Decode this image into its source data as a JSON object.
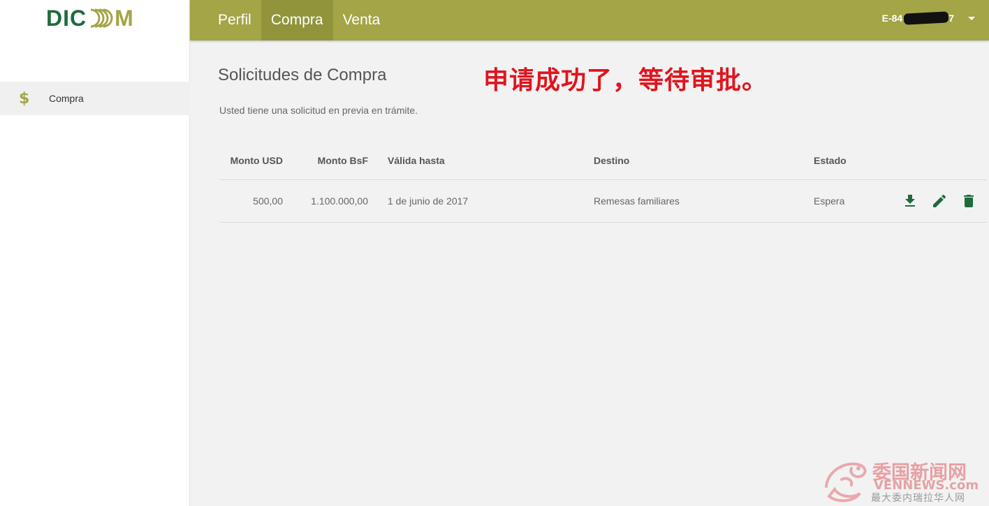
{
  "app": {
    "logo_text": "DIC",
    "logo_text_end": "M"
  },
  "sidebar": {
    "items": [
      {
        "icon": "dollar-icon",
        "icon_glyph": "$",
        "label": "Compra"
      }
    ]
  },
  "header": {
    "tabs": [
      {
        "label": "Perfil",
        "active": false
      },
      {
        "label": "Compra",
        "active": true
      },
      {
        "label": "Venta",
        "active": false
      }
    ],
    "user": {
      "id_prefix": "E-84",
      "id_suffix": "7",
      "menu_icon": "caret-down-icon"
    }
  },
  "main": {
    "title": "Solicitudes de Compra",
    "annotation": "申请成功了，等待审批。",
    "subtitle": "Usted tiene una solicitud en previa en trámite.",
    "table": {
      "headers": [
        "Monto USD",
        "Monto BsF",
        "Válida hasta",
        "Destino",
        "Estado"
      ],
      "rows": [
        {
          "monto_usd": "500,00",
          "monto_bsf": "1.100.000,00",
          "valida_hasta": "1 de junio de 2017",
          "destino": "Remesas familiares",
          "estado": "Espera",
          "actions": [
            "download-icon",
            "edit-icon",
            "delete-icon"
          ]
        }
      ]
    }
  },
  "watermark": {
    "cn": "委国新闻网",
    "en": "VENNEWS.com",
    "sub": "最大委内瑞拉华人网"
  },
  "colors": {
    "accent": "#a3a546",
    "accent_dark": "#91943b",
    "logo_green": "#1e6b3e",
    "action_green": "#1e6b3e",
    "annotation_red": "#e0141e"
  }
}
